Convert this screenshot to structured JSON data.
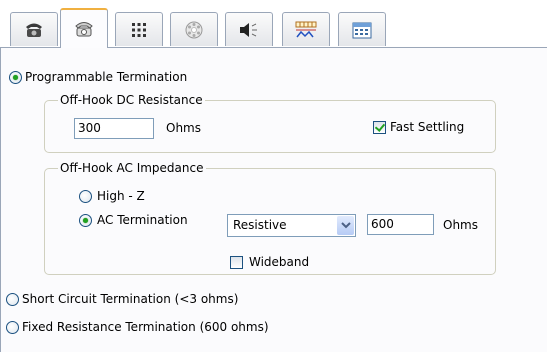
{
  "tabs": [
    {
      "icon": "telephone-icon"
    },
    {
      "icon": "telephone-outline-icon",
      "active": true
    },
    {
      "icon": "keypad-icon"
    },
    {
      "icon": "dial-icon"
    },
    {
      "icon": "speaker-icon"
    },
    {
      "icon": "waveform-icon"
    },
    {
      "icon": "calendar-icon"
    }
  ],
  "termination": {
    "programmable_label": "Programmable Termination",
    "programmable_selected": true,
    "short_circuit_label": "Short Circuit Termination (<3 ohms)",
    "fixed_resistance_label": "Fixed Resistance Termination (600 ohms)"
  },
  "dc_group": {
    "title": "Off-Hook DC Resistance",
    "value": "300",
    "unit": "Ohms",
    "fast_settling_label": "Fast Settling",
    "fast_settling_checked": true
  },
  "ac_group": {
    "title": "Off-Hook AC Impedance",
    "highz_label": "High - Z",
    "ac_termination_label": "AC Termination",
    "ac_termination_selected": true,
    "type_selected": "Resistive",
    "impedance_value": "600",
    "unit": "Ohms",
    "wideband_label": "Wideband",
    "wideband_checked": false
  },
  "colors": {
    "radio_dot": "#21a121",
    "active_tab_accent": "#f0b040",
    "input_border": "#7f9db9"
  }
}
